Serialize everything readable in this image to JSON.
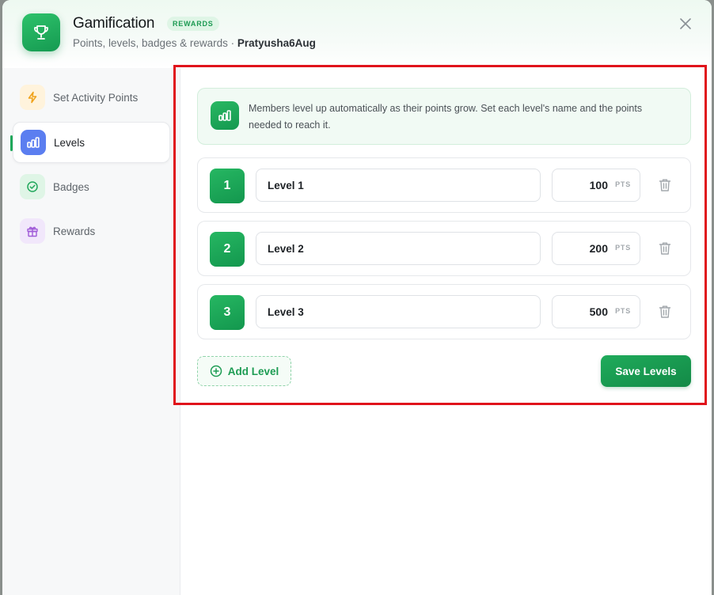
{
  "header": {
    "title": "Gamification",
    "badge": "REWARDS",
    "subtitle": "Points, levels, badges & rewards · ",
    "user": "Pratyusha6Aug",
    "app_icon": "trophy-icon",
    "close_icon": "close-icon"
  },
  "sidebar": {
    "items": [
      {
        "label": "Set Activity Points",
        "icon": "lightning-icon",
        "active": false
      },
      {
        "label": "Levels",
        "icon": "bar-chart-icon",
        "active": true
      },
      {
        "label": "Badges",
        "icon": "check-circle-icon",
        "active": false
      },
      {
        "label": "Rewards",
        "icon": "gift-icon",
        "active": false
      }
    ]
  },
  "main": {
    "info_text": "Members level up automatically as their points grow. Set each level's name and the points needed to reach it.",
    "levels": [
      {
        "number": "1",
        "name": "Level 1",
        "points": "100",
        "unit": "PTS"
      },
      {
        "number": "2",
        "name": "Level 2",
        "points": "200",
        "unit": "PTS"
      },
      {
        "number": "3",
        "name": "Level 3",
        "points": "500",
        "unit": "PTS"
      }
    ],
    "add_label": "Add Level",
    "save_label": "Save Levels"
  },
  "colors": {
    "accent": "#1fa75a",
    "highlight": "#e0131b"
  }
}
